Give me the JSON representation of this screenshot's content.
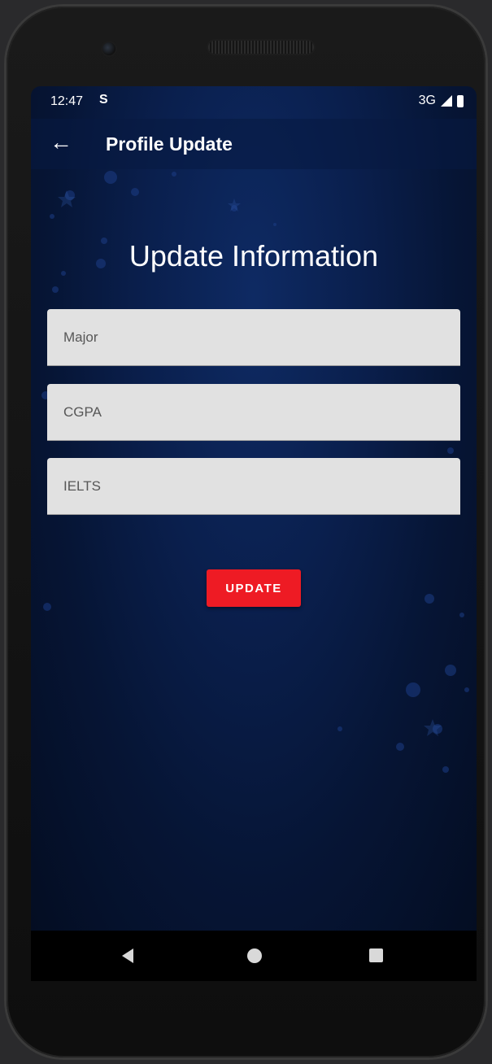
{
  "status_bar": {
    "time": "12:47",
    "notification_icon": "S",
    "network": "3G"
  },
  "app_bar": {
    "title": "Profile Update"
  },
  "form": {
    "heading": "Update Information",
    "fields": [
      {
        "name": "major",
        "placeholder": "Major",
        "value": ""
      },
      {
        "name": "cgpa",
        "placeholder": "CGPA",
        "value": ""
      },
      {
        "name": "ielts",
        "placeholder": "IELTS",
        "value": ""
      }
    ],
    "submit_label": "UPDATE"
  },
  "colors": {
    "accent": "#ee1b24",
    "background": "#0a1f4d",
    "field": "#e1e1e1"
  },
  "icons": {
    "back": "arrow-left-icon",
    "nav_back": "triangle-back-icon",
    "nav_home": "circle-home-icon",
    "nav_recents": "square-recents-icon"
  }
}
